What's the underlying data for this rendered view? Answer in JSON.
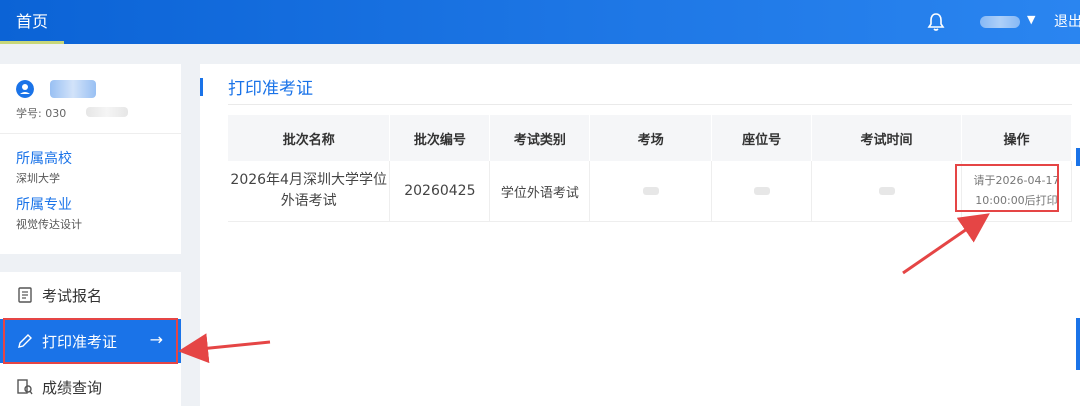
{
  "header": {
    "home_tab": "首页",
    "bell_icon": "bell-icon",
    "logout": "退出"
  },
  "profile": {
    "student_id_label": "学号: 030",
    "school_label": "所属高校",
    "school_value": "深圳大学",
    "major_label": "所属专业",
    "major_value": "视觉传达设计"
  },
  "menu": {
    "items": [
      {
        "label": "考试报名",
        "icon": "document-icon"
      },
      {
        "label": "打印准考证",
        "icon": "pencil-icon",
        "arrow": "→"
      },
      {
        "label": "成绩查询",
        "icon": "search-doc-icon"
      }
    ]
  },
  "main": {
    "title": "打印准考证",
    "table": {
      "headers": [
        "批次名称",
        "批次编号",
        "考试类别",
        "考场",
        "座位号",
        "考试时间",
        "操作"
      ],
      "rows": [
        {
          "batch_name": "2026年4月深圳大学学位外语考试",
          "batch_no": "20260425",
          "category": "学位外语考试",
          "operation": "请于2026-04-17 10:00:00后打印"
        }
      ]
    }
  },
  "colors": {
    "primary": "#1a73e8",
    "highlight": "#e54545"
  }
}
